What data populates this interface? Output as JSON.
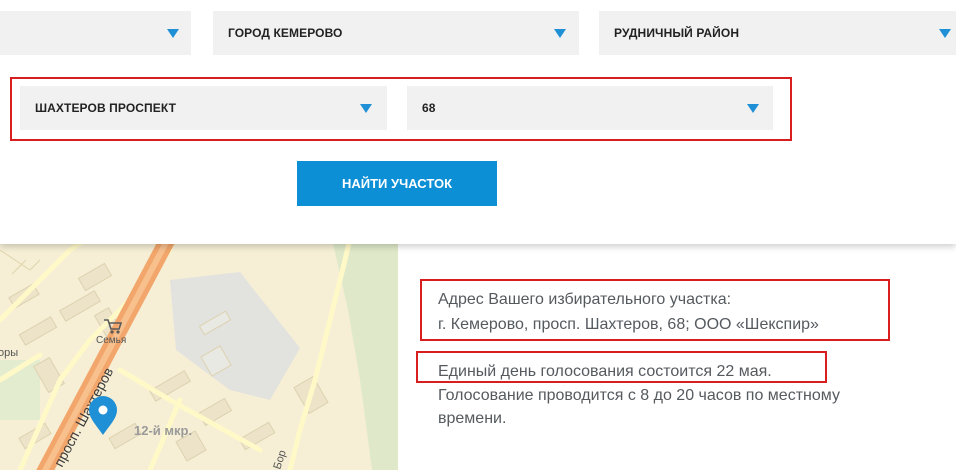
{
  "filters": {
    "row1": [
      {
        "value": ""
      },
      {
        "value": "ГОРОД КЕМЕРОВО"
      },
      {
        "value": "РУДНИЧНЫЙ РАЙОН"
      }
    ],
    "street": {
      "value": "ШАХТЕРОВ ПРОСПЕКТ"
    },
    "house": {
      "value": "68"
    }
  },
  "find_button": {
    "label": "НАЙТИ УЧАСТОК"
  },
  "map": {
    "labels": {
      "street_main": "просп. Шахтеров",
      "district": "12-й мкр.",
      "shop": "Семья",
      "bor": "Бор",
      "left_edge": "оры"
    },
    "colors": {
      "background": "#f6efd6",
      "main_road": "#f2a66b",
      "minor_road": "#fff9c8",
      "building": "#ece3c8",
      "park": "#dfe9c9",
      "marker": "#1f8fd6"
    }
  },
  "info": {
    "address_title": "Адрес Вашего избирательного участка:",
    "address_value": "г. Кемерово, просп. Шахтеров, 68; ООО «Шекспир»",
    "voting_day": "Единый день голосования состоится 22 мая.",
    "voting_hours_1": "Голосование проводится с 8 до 20 часов по местному",
    "voting_hours_2": "времени."
  },
  "colors": {
    "accent": "#0d8fd6",
    "highlight": "#d81e1e",
    "select_bg": "#f1f1f1",
    "text": "#555a5f"
  }
}
